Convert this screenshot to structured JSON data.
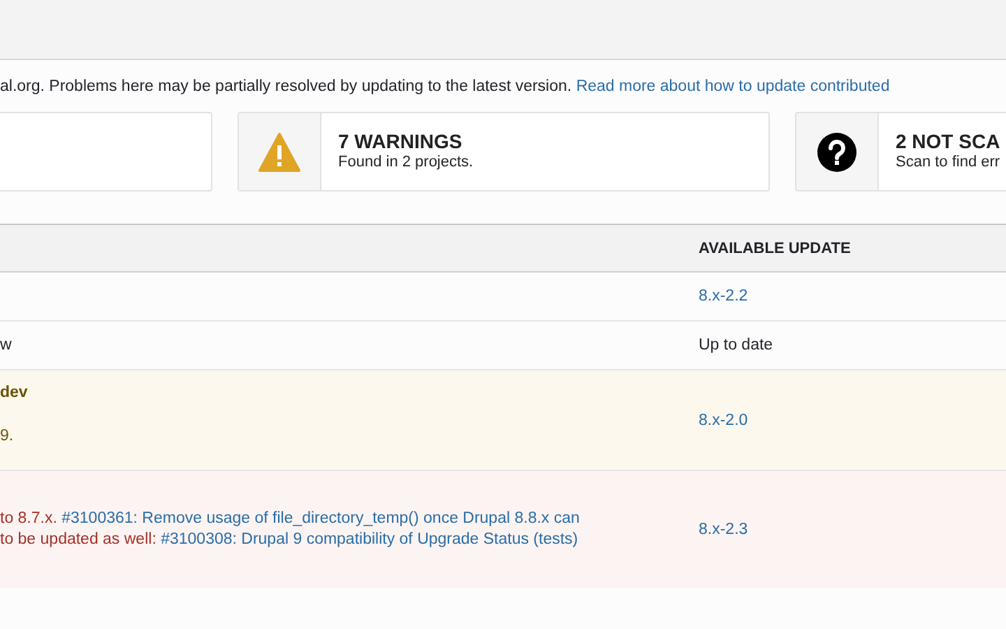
{
  "intro": {
    "text": "al.org. Problems here may be partially resolved by updating to the latest version.",
    "link": "Read more about how to update contributed"
  },
  "summary": [
    {
      "kind": "blank"
    },
    {
      "kind": "warning",
      "title": "7 WARNINGS",
      "subtitle": "Found in 2 projects."
    },
    {
      "kind": "unknown",
      "title": "2 NOT SCA",
      "subtitle": "Scan to find err"
    }
  ],
  "table": {
    "columns": [
      "",
      "AVAILABLE UPDATE"
    ],
    "rows": [
      {
        "kind": "plain",
        "lines": [],
        "update": {
          "text": "8.x-2.2",
          "kind": "link"
        }
      },
      {
        "kind": "plain",
        "lines": [
          [
            {
              "kind": "text",
              "text": "w"
            }
          ]
        ],
        "update": {
          "text": "Up to date",
          "kind": "text"
        }
      },
      {
        "kind": "warning",
        "title": "dev",
        "lines": [
          [
            {
              "kind": "text",
              "text": "9."
            }
          ]
        ],
        "update": {
          "text": "8.x-2.0",
          "kind": "link"
        }
      },
      {
        "kind": "error",
        "lines": [
          [
            {
              "kind": "text",
              "text": "to 8.7.x."
            },
            {
              "kind": "link",
              "text": "#3100361: Remove usage of file_directory_temp() once Drupal 8.8.x can"
            }
          ],
          [
            {
              "kind": "text",
              "text": "to be updated as well:"
            },
            {
              "kind": "link",
              "text": "#3100308: Drupal 9 compatibility of Upgrade Status (tests)"
            }
          ]
        ],
        "update": {
          "text": "8.x-2.3",
          "kind": "link"
        }
      }
    ]
  }
}
